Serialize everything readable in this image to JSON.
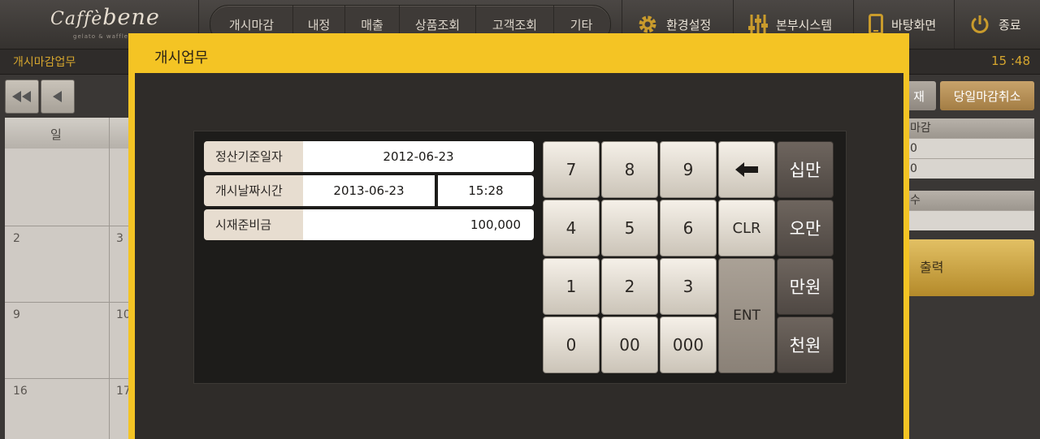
{
  "logo": {
    "brand_left": "Caffè",
    "brand_right": "bene",
    "tagline": "gelato & waffle"
  },
  "nav": {
    "items": [
      "개시마감",
      "내정",
      "매출",
      "상품조회",
      "고객조회",
      "기타"
    ]
  },
  "top_buttons": {
    "settings": "환경설정",
    "hq_system": "본부시스템",
    "desktop": "바탕화면",
    "exit": "종료"
  },
  "subbar": {
    "title": "개시마감업무",
    "clock": "15 :48"
  },
  "calendar": {
    "weekday": "일",
    "days": [
      "2",
      "3",
      "9",
      "10",
      "16",
      "17"
    ]
  },
  "right_panel": {
    "btn_partial": "재",
    "btn_cancel_close": "당일마감취소",
    "label_close": "마감",
    "val_1": "0",
    "val_2": "0",
    "label_count": "수",
    "print": "출력"
  },
  "modal": {
    "title": "개시업무",
    "fields": {
      "settle_date_label": "정산기준일자",
      "settle_date_value": "2012-06-23",
      "open_datetime_label": "개시날짜시간",
      "open_date_value": "2013-06-23",
      "open_time_value": "15:28",
      "cash_label": "시재준비금",
      "cash_value": "100,000"
    },
    "keypad": {
      "k7": "7",
      "k8": "8",
      "k9": "9",
      "k4": "4",
      "k5": "5",
      "k6": "6",
      "k1": "1",
      "k2": "2",
      "k3": "3",
      "k0": "0",
      "k00": "00",
      "k000": "000",
      "clr": "CLR",
      "ent": "ENT",
      "amt_100k": "십만",
      "amt_50k": "오만",
      "amt_10k": "만원",
      "amt_1k": "천원"
    }
  },
  "colors": {
    "modal_frame": "#f4c424",
    "accent_text": "#d6a62e",
    "print_button": "#c9a13e"
  },
  "icons": {
    "backspace": "backspace-arrow-icon",
    "settings": "gear-icon",
    "hq": "sliders-icon",
    "desktop": "tablet-icon",
    "exit": "power-icon"
  }
}
